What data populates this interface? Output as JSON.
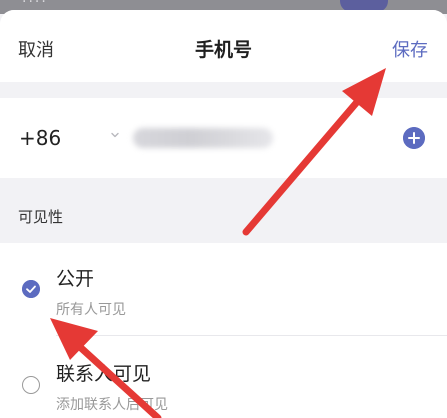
{
  "header": {
    "cancel_label": "取消",
    "title": "手机号",
    "save_label": "保存"
  },
  "phone": {
    "country_code": "+86",
    "number_obscured": true
  },
  "visibility": {
    "section_label": "可见性",
    "options": [
      {
        "label": "公开",
        "description": "所有人可见",
        "selected": true
      },
      {
        "label": "联系人可见",
        "description": "添加联系人后可见",
        "selected": false
      }
    ]
  },
  "colors": {
    "accent": "#5c6bc0",
    "annotation_arrow": "#e53935"
  },
  "icons": {
    "country_dropdown": "chevron-down-icon",
    "add": "plus-circle-icon",
    "selected": "check-circle-icon",
    "unselected": "radio-empty-icon"
  }
}
